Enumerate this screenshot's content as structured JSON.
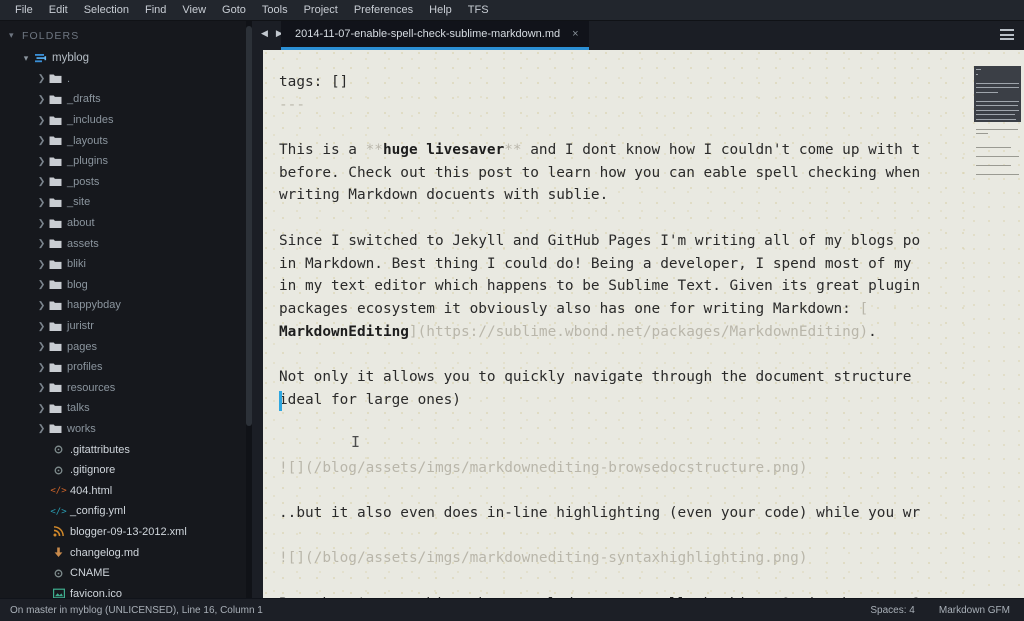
{
  "menubar": {
    "items": [
      {
        "label": "File"
      },
      {
        "label": "Edit"
      },
      {
        "label": "Selection"
      },
      {
        "label": "Find"
      },
      {
        "label": "View"
      },
      {
        "label": "Goto"
      },
      {
        "label": "Tools"
      },
      {
        "label": "Project"
      },
      {
        "label": "Preferences"
      },
      {
        "label": "Help"
      },
      {
        "label": "TFS"
      }
    ]
  },
  "sidebar": {
    "header": "FOLDERS",
    "root": {
      "label": "myblog",
      "icon": "git-branch-icon"
    },
    "folders": [
      {
        "label": ".",
        "icon": "folder-icon"
      },
      {
        "label": "_drafts",
        "icon": "folder-icon"
      },
      {
        "label": "_includes",
        "icon": "folder-icon"
      },
      {
        "label": "_layouts",
        "icon": "folder-icon"
      },
      {
        "label": "_plugins",
        "icon": "folder-icon"
      },
      {
        "label": "_posts",
        "icon": "folder-icon"
      },
      {
        "label": "_site",
        "icon": "folder-icon"
      },
      {
        "label": "about",
        "icon": "folder-icon"
      },
      {
        "label": "assets",
        "icon": "folder-icon"
      },
      {
        "label": "bliki",
        "icon": "folder-icon"
      },
      {
        "label": "blog",
        "icon": "folder-icon"
      },
      {
        "label": "happybday",
        "icon": "folder-icon"
      },
      {
        "label": "juristr",
        "icon": "folder-icon"
      },
      {
        "label": "pages",
        "icon": "folder-icon"
      },
      {
        "label": "profiles",
        "icon": "folder-icon"
      },
      {
        "label": "resources",
        "icon": "folder-icon"
      },
      {
        "label": "talks",
        "icon": "folder-icon"
      },
      {
        "label": "works",
        "icon": "folder-icon"
      }
    ],
    "files": [
      {
        "label": ".gitattributes",
        "icon": "gear-file-icon",
        "color": "#7f8c8d"
      },
      {
        "label": ".gitignore",
        "icon": "gear-file-icon",
        "color": "#7f8c8d"
      },
      {
        "label": "404.html",
        "icon": "html-tag-icon",
        "color": "#d2662a"
      },
      {
        "label": "_config.yml",
        "icon": "code-tag-icon",
        "color": "#2a9fb5"
      },
      {
        "label": "blogger-09-13-2012.xml",
        "icon": "rss-icon",
        "color": "#d2892a"
      },
      {
        "label": "changelog.md",
        "icon": "markdown-icon",
        "color": "#c98a4b"
      },
      {
        "label": "CNAME",
        "icon": "gear-file-icon",
        "color": "#7f8c8d"
      },
      {
        "label": "favicon.ico",
        "icon": "image-icon",
        "color": "#3fae8f"
      }
    ]
  },
  "tabbar": {
    "back_arrow": "◀",
    "forward_arrow": "▶",
    "tab_title": "2014-11-07-enable-spell-check-sublime-markdown.md",
    "close_label": "×",
    "accent_color": "#2b8fd4"
  },
  "editor": {
    "lines": [
      {
        "segments": [
          {
            "t": "tags: []",
            "c": "plain"
          }
        ]
      },
      {
        "segments": [
          {
            "t": "---",
            "c": "punct"
          }
        ]
      },
      {
        "segments": []
      },
      {
        "segments": [
          {
            "t": "This is a ",
            "c": "plain"
          },
          {
            "t": "**",
            "c": "punct"
          },
          {
            "t": "huge livesaver",
            "c": "bold"
          },
          {
            "t": "**",
            "c": "punct"
          },
          {
            "t": " and I dont know how I couldn't come up with t",
            "c": "plain"
          }
        ]
      },
      {
        "segments": [
          {
            "t": "before. Check out this post to learn how you can eable spell checking when",
            "c": "plain"
          }
        ]
      },
      {
        "segments": [
          {
            "t": "writing Markdown docuents with sublie.",
            "c": "plain"
          }
        ]
      },
      {
        "segments": []
      },
      {
        "segments": [
          {
            "t": "Since I switched to Jekyll and GitHub Pages I'm writing all of my blogs po",
            "c": "plain"
          }
        ]
      },
      {
        "segments": [
          {
            "t": "in Markdown. Best thing I could do! Being a developer, I spend most of my",
            "c": "plain"
          }
        ]
      },
      {
        "segments": [
          {
            "t": "in my text editor which happens to be Sublime Text. Given its great plugin",
            "c": "plain"
          }
        ]
      },
      {
        "segments": [
          {
            "t": "packages ecosystem it obviously also has one for writing Markdown: ",
            "c": "plain"
          },
          {
            "t": "[",
            "c": "punct"
          }
        ]
      },
      {
        "segments": [
          {
            "t": "MarkdownEditing",
            "c": "bold"
          },
          {
            "t": "](https://sublime.wbond.net/packages/MarkdownEditing)",
            "c": "url"
          },
          {
            "t": ".",
            "c": "plain"
          }
        ]
      },
      {
        "segments": []
      },
      {
        "segments": [
          {
            "t": "Not only it allows you to quickly navigate through the document structure",
            "c": "plain"
          }
        ]
      },
      {
        "segments": [
          {
            "t": "ideal for large ones)",
            "c": "plain"
          }
        ]
      },
      {
        "segments": []
      },
      {
        "segments": []
      },
      {
        "segments": [
          {
            "t": "![](/blog/assets/imgs/markdownediting-browsedocstructure.png)",
            "c": "img"
          }
        ]
      },
      {
        "segments": []
      },
      {
        "segments": [
          {
            "t": "..but it also even does in-line highlighting (even your code) while you wr",
            "c": "plain"
          }
        ]
      },
      {
        "segments": []
      },
      {
        "segments": [
          {
            "t": "![](/blog/assets/imgs/markdownediting-syntaxhighlighting.png)",
            "c": "img"
          }
        ]
      },
      {
        "segments": []
      },
      {
        "segments": [
          {
            "t": "But there's one thing that puzzled me: no spell checking. Or is there one?",
            "c": "plain"
          }
        ]
      }
    ],
    "cursor_color": "#2ea7e0",
    "mouse_cursor": "I"
  },
  "statusbar": {
    "left": "On master in myblog (UNLICENSED), Line 16, Column 1",
    "spaces": "Spaces: 4",
    "syntax": "Markdown GFM"
  }
}
